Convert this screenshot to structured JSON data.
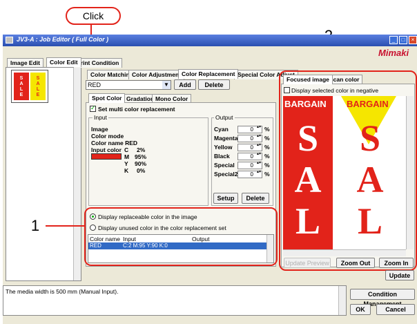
{
  "annotations": {
    "click": "Click",
    "n1": "1",
    "n2": "2"
  },
  "window": {
    "title": "JV3-A : Job Editor ( Full Color )",
    "brand": "Mimaki"
  },
  "top_tabs": [
    "Image Edit",
    "Color Edit",
    "Print Condition"
  ],
  "sub_tabs": [
    "Color Matching",
    "Color Adjustment",
    "Color Replacement",
    "Special Color Adjust"
  ],
  "select": {
    "value": "RED",
    "add": "Add",
    "delete": "Delete"
  },
  "inner_tabs": [
    "Spot Color",
    "Gradation",
    "Mono Color"
  ],
  "set_multi": "Set multi color replacement",
  "input": {
    "header": "Input",
    "image": "Image",
    "color_mode": "Color mode",
    "color_name": "Color name RED",
    "input_color": "Input color",
    "c": "C",
    "c_val": "2%",
    "m": "M",
    "m_val": "95%",
    "y": "Y",
    "y_val": "90%",
    "k": "K",
    "k_val": "0%"
  },
  "output": {
    "header": "Output",
    "rows": [
      {
        "label": "Cyan",
        "val": "0"
      },
      {
        "label": "Magenta",
        "val": "0"
      },
      {
        "label": "Yellow",
        "val": "0"
      },
      {
        "label": "Black",
        "val": "0"
      },
      {
        "label": "Special",
        "val": "0"
      },
      {
        "label": "Special2",
        "val": "0"
      }
    ],
    "unit": "%",
    "setup": "Setup",
    "delete": "Delete"
  },
  "display": {
    "replaceable": "Display replaceable color in the image",
    "unused": "Display unused color in the color replacement set"
  },
  "table": {
    "headers": [
      "Color name",
      "Input",
      "Output"
    ],
    "row": {
      "name": "RED",
      "input": "C:2 M:95 Y:90 K:0",
      "output": ""
    }
  },
  "preview": {
    "tabs": [
      "Focused image",
      "Scan color"
    ],
    "negative": "Display selected color in negative",
    "banner": "BARGAIN",
    "sale": [
      "S",
      "A",
      "L"
    ],
    "update_preview": "Update Preview",
    "zoom_out": "Zoom Out",
    "zoom_in": "Zoom In",
    "update": "Update"
  },
  "thumb": {
    "sale": [
      "S",
      "A",
      "L",
      "E"
    ]
  },
  "status": {
    "message": "The media width is 500 mm (Manual Input).",
    "condition": "Condition Management",
    "ok": "OK",
    "cancel": "Cancel"
  },
  "colors": {
    "titlebar": "#3b5fc0",
    "red": "#e2231a",
    "yellow": "#f5e600",
    "annot": "#e2231a"
  }
}
